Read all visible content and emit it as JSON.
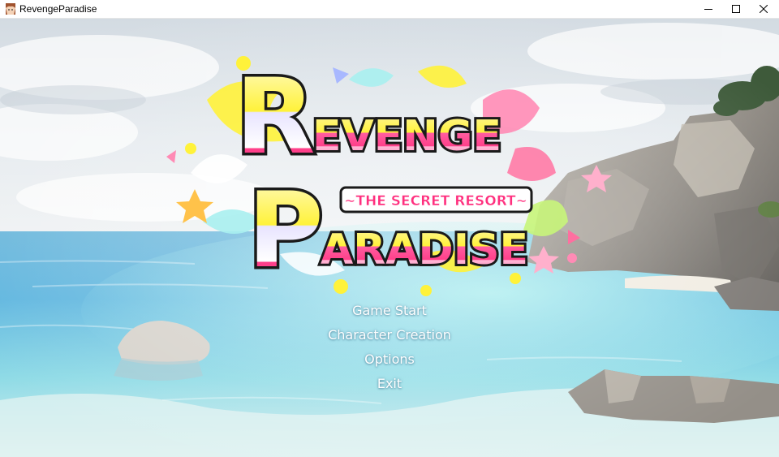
{
  "window": {
    "title": "RevengeParadise",
    "app_icon": "game-character-icon",
    "controls": {
      "minimize": "minimize-icon",
      "maximize": "maximize-icon",
      "close": "close-icon"
    }
  },
  "logo": {
    "line1": "REVENGE",
    "line2": "PARADISE",
    "subtitle": "~THE SECRET RESORT~",
    "colors": {
      "pink": "#ff3f8a",
      "yellow": "#fff23a",
      "lavender": "#e8e4ff",
      "outline": "#1a1a1a"
    }
  },
  "menu": {
    "items": [
      {
        "label": "Game Start"
      },
      {
        "label": "Character Creation"
      },
      {
        "label": "Options"
      },
      {
        "label": "Exit"
      }
    ]
  },
  "scene": {
    "background": "tropical-beach-with-rocky-cliffs",
    "colors": {
      "sky": "#dfe6ec",
      "sea_deep": "#4aa8d8",
      "sea_shallow": "#9fe6ec",
      "rock": "#8e8a84"
    }
  }
}
